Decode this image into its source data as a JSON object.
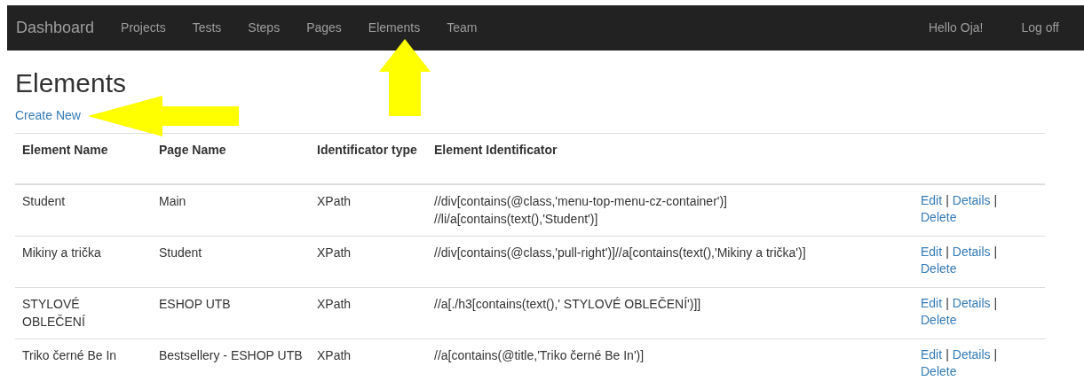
{
  "navbar": {
    "brand": "Dashboard",
    "links": [
      "Projects",
      "Tests",
      "Steps",
      "Pages",
      "Elements",
      "Team"
    ],
    "greeting": "Hello Oja!",
    "logout": "Log off"
  },
  "page": {
    "title": "Elements",
    "create_link": "Create New"
  },
  "table": {
    "columns": [
      "Element Name",
      "Page Name",
      "Identificator type",
      "Element Identificator"
    ],
    "rows": [
      {
        "cells": [
          "Student",
          "Main",
          "XPath",
          "//div[contains(@class,'menu-top-menu-cz-container')] //li/a[contains(text(),'Student')]"
        ],
        "actions": [
          {
            "kind": "link",
            "text": "Edit"
          },
          {
            "kind": "separator",
            "text": "|"
          },
          {
            "kind": "link",
            "text": "Details"
          },
          {
            "kind": "separator",
            "text": "|"
          },
          {
            "kind": "link",
            "text": "Delete"
          }
        ]
      },
      {
        "cells": [
          "Mikiny a trička",
          "Student",
          "XPath",
          "//div[contains(@class,'pull-right')]//a[contains(text(),'Mikiny a trička')]"
        ],
        "actions": [
          {
            "kind": "link",
            "text": "Edit"
          },
          {
            "kind": "separator",
            "text": "|"
          },
          {
            "kind": "link",
            "text": "Details"
          },
          {
            "kind": "separator",
            "text": "|"
          },
          {
            "kind": "link",
            "text": "Delete"
          }
        ]
      },
      {
        "cells": [
          "STYLOVÉ OBLEČENÍ",
          "ESHOP UTB",
          "XPath",
          "//a[./h3[contains(text(),' STYLOVÉ OBLEČENÍ')]]"
        ],
        "actions": [
          {
            "kind": "link",
            "text": "Edit"
          },
          {
            "kind": "separator",
            "text": "|"
          },
          {
            "kind": "link",
            "text": "Details"
          },
          {
            "kind": "separator",
            "text": "|"
          },
          {
            "kind": "link",
            "text": "Delete"
          }
        ]
      },
      {
        "cells": [
          "Triko černé Be In",
          "Bestsellery - ESHOP UTB",
          "XPath",
          "//a[contains(@title,'Triko černé Be In')]"
        ],
        "actions": [
          {
            "kind": "link",
            "text": "Edit"
          },
          {
            "kind": "separator",
            "text": "|"
          },
          {
            "kind": "link",
            "text": "Details"
          },
          {
            "kind": "separator",
            "text": "|"
          },
          {
            "kind": "link",
            "text": "Delete"
          }
        ]
      }
    ]
  }
}
